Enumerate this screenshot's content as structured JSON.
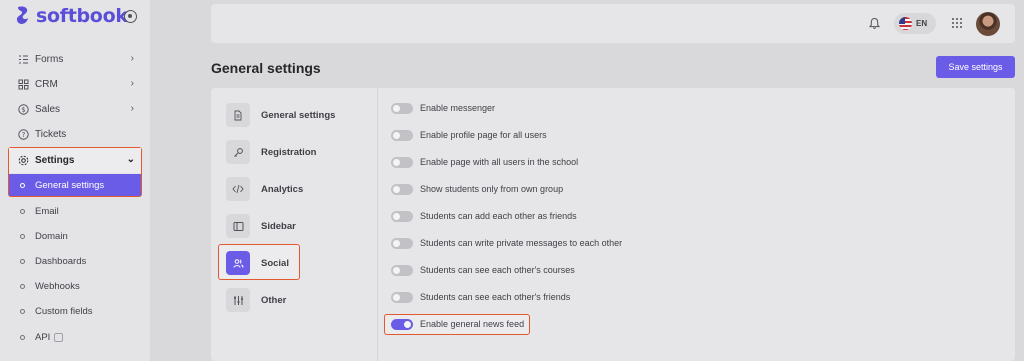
{
  "brand": {
    "name": "softbook"
  },
  "sidebar": {
    "items": [
      {
        "label": "Forms",
        "icon": "list-icon"
      },
      {
        "label": "CRM",
        "icon": "grid-icon"
      },
      {
        "label": "Sales",
        "icon": "dollar-icon"
      },
      {
        "label": "Tickets",
        "icon": "help-icon"
      }
    ],
    "settings": {
      "label": "Settings",
      "icon": "gear-icon",
      "subitems": [
        {
          "label": "General settings",
          "active": true
        },
        {
          "label": "Email"
        },
        {
          "label": "Domain"
        },
        {
          "label": "Dashboards"
        },
        {
          "label": "Webhooks"
        },
        {
          "label": "Custom fields"
        },
        {
          "label": "API"
        }
      ]
    }
  },
  "topbar": {
    "language": "EN"
  },
  "header": {
    "title": "General settings",
    "save_label": "Save settings"
  },
  "categories": [
    {
      "label": "General settings",
      "icon": "document-icon"
    },
    {
      "label": "Registration",
      "icon": "key-icon"
    },
    {
      "label": "Analytics",
      "icon": "code-icon"
    },
    {
      "label": "Sidebar",
      "icon": "sidebar-icon"
    },
    {
      "label": "Social",
      "icon": "users-icon",
      "active": true
    },
    {
      "label": "Other",
      "icon": "sliders-icon"
    }
  ],
  "toggles": [
    {
      "label": "Enable messenger",
      "on": false
    },
    {
      "label": "Enable profile page for all users",
      "on": false
    },
    {
      "label": "Enable page with all users in the school",
      "on": false
    },
    {
      "label": "Show students only from own group",
      "on": false
    },
    {
      "label": "Students can add each other as friends",
      "on": false
    },
    {
      "label": "Students can write private messages to each other",
      "on": false
    },
    {
      "label": "Students can see each other's courses",
      "on": false
    },
    {
      "label": "Students can see each other's friends",
      "on": false
    },
    {
      "label": "Enable general news feed",
      "on": true
    }
  ],
  "colors": {
    "accent": "#6b5ce7",
    "highlight": "#e2592f"
  }
}
